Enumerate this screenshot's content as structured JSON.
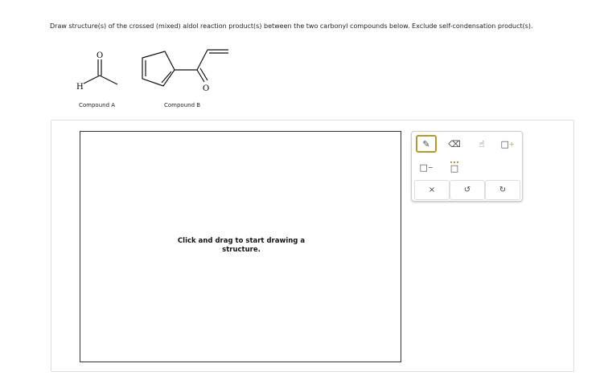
{
  "question": "Draw structure(s) of the crossed (mixed) aldol reaction product(s) between the two carbonyl compounds below. Exclude self-condensation product(s).",
  "compounds": [
    {
      "label": "Compound A",
      "atoms": [
        "O",
        "H"
      ]
    },
    {
      "label": "Compound B",
      "atoms": [
        "O"
      ]
    }
  ],
  "canvas": {
    "hint": "Click and drag to start drawing a structure."
  },
  "toolbar": {
    "tools": [
      "pencil-icon",
      "eraser-icon",
      "hand-icon",
      "add-charge-icon",
      "remove-charge-icon",
      "lone-pair-icon"
    ],
    "actions": {
      "clear": "×",
      "undo": "↺",
      "redo": "↻"
    },
    "accent": "#b8972c"
  }
}
